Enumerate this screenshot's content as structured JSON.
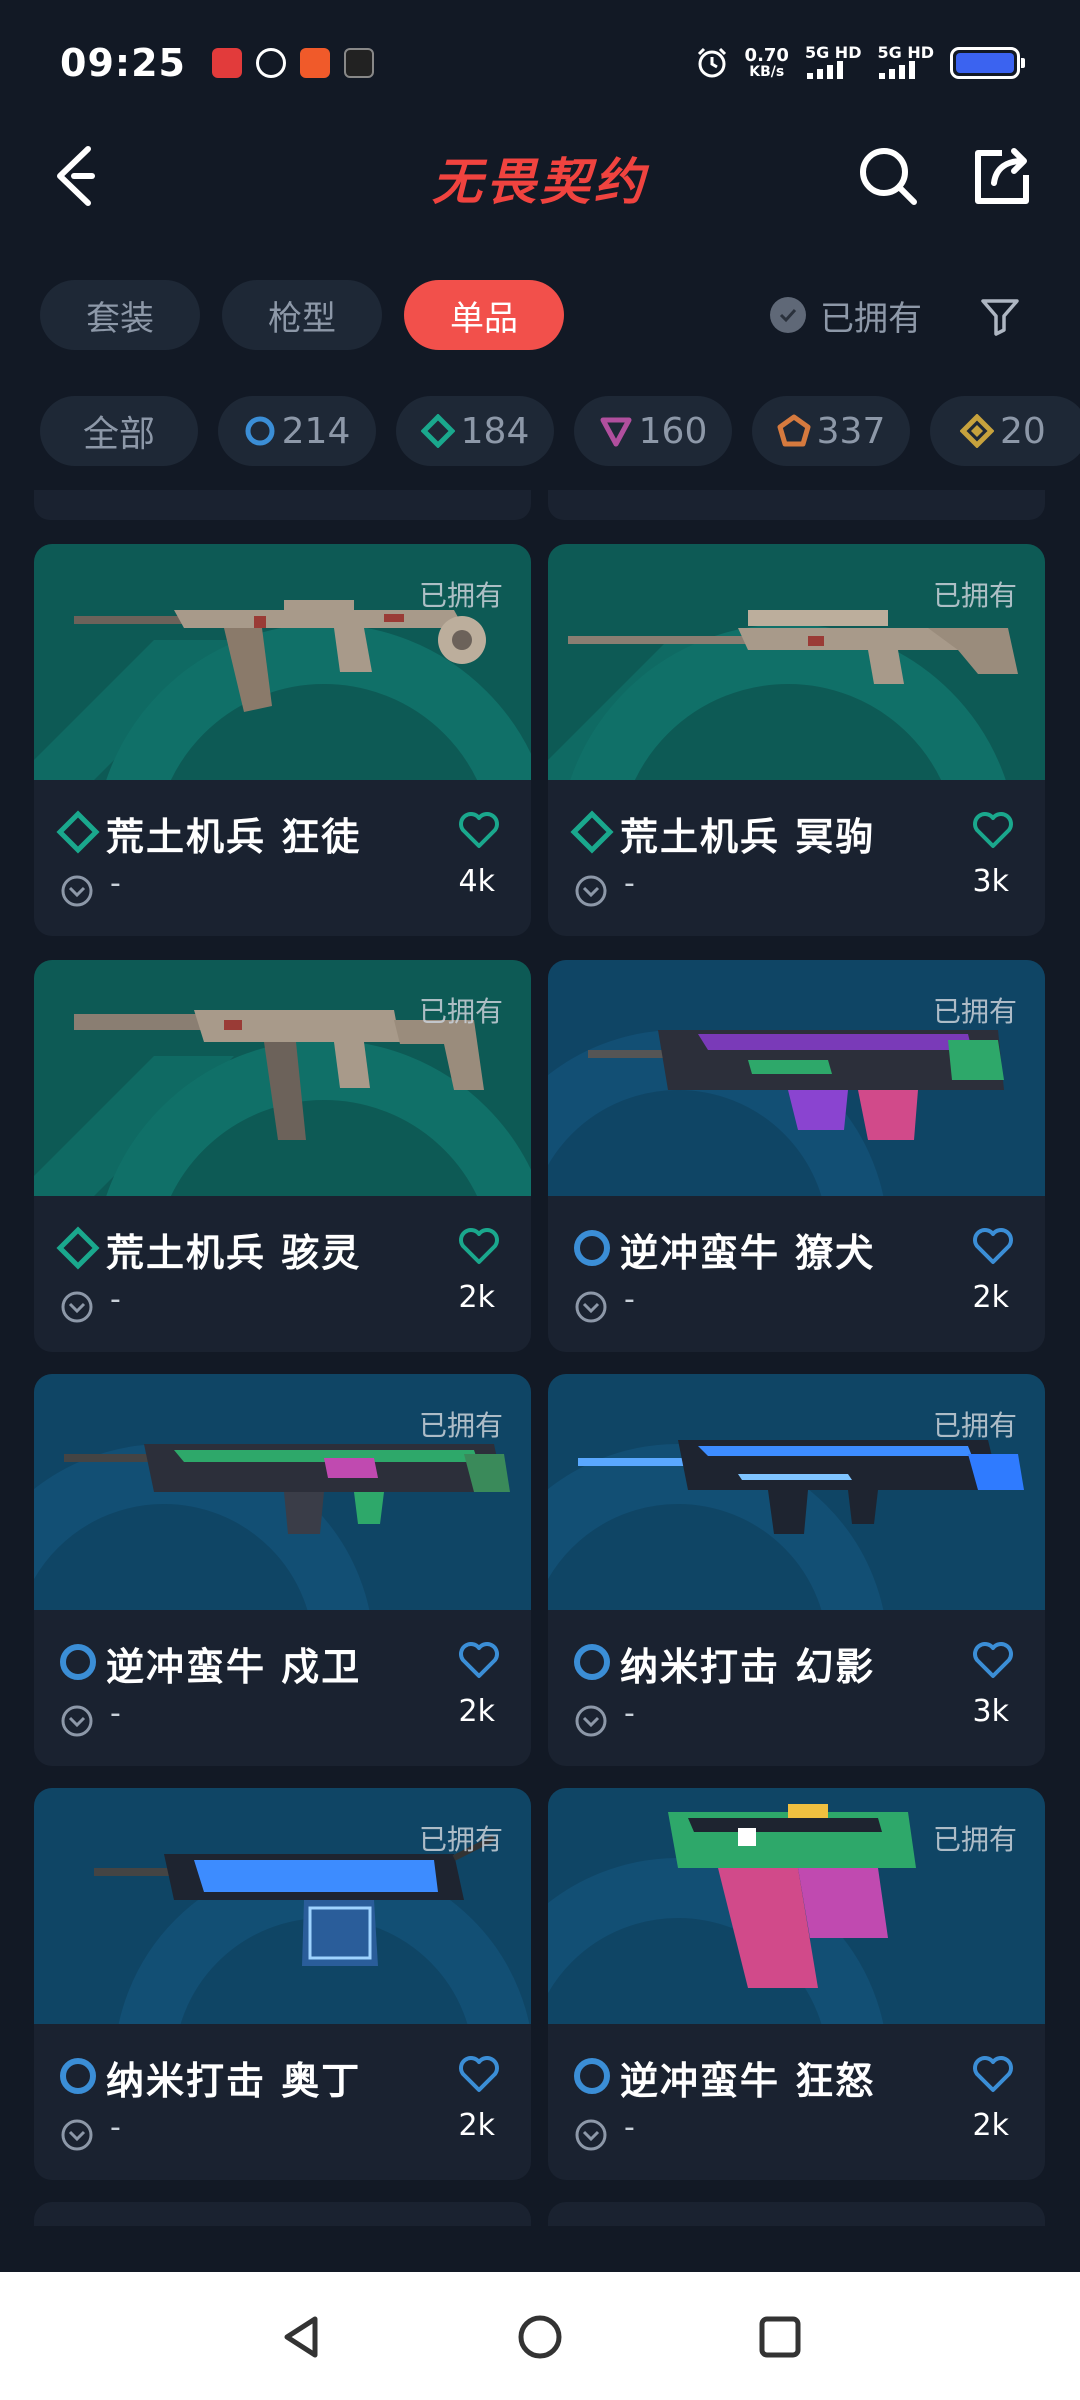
{
  "status_bar": {
    "time": "09:25",
    "net_speed_value": "0.70",
    "net_speed_unit": "KB/s",
    "signal_1": "5G HD",
    "signal_2": "5G HD"
  },
  "header": {
    "title": "无畏契约"
  },
  "category_tabs": [
    {
      "label": "套装"
    },
    {
      "label": "枪型"
    },
    {
      "label": "单品",
      "active": true
    }
  ],
  "owned_filter": {
    "label": "已拥有"
  },
  "tier_chips": [
    {
      "label": "全部"
    },
    {
      "label": "214",
      "tier_color": "#3b8ed6"
    },
    {
      "label": "184",
      "tier_color": "#1aa88d"
    },
    {
      "label": "160",
      "tier_color": "#b14f9e"
    },
    {
      "label": "337",
      "tier_color": "#d67a3e"
    },
    {
      "label": "20",
      "tier_color": "#c7a23d"
    }
  ],
  "items": [
    {
      "name": "荒土机兵 狂徒",
      "owned_label": "已拥有",
      "sub": "-",
      "count": "4k",
      "tier": "green",
      "bg": "teal"
    },
    {
      "name": "荒土机兵 冥驹",
      "owned_label": "已拥有",
      "sub": "-",
      "count": "3k",
      "tier": "green",
      "bg": "teal"
    },
    {
      "name": "荒土机兵 骇灵",
      "owned_label": "已拥有",
      "sub": "-",
      "count": "2k",
      "tier": "green",
      "bg": "teal"
    },
    {
      "name": "逆冲蛮牛 獠犬",
      "owned_label": "已拥有",
      "sub": "-",
      "count": "2k",
      "tier": "blue",
      "bg": "blue"
    },
    {
      "name": "逆冲蛮牛 戍卫",
      "owned_label": "已拥有",
      "sub": "-",
      "count": "2k",
      "tier": "blue",
      "bg": "blue"
    },
    {
      "name": "纳米打击 幻影",
      "owned_label": "已拥有",
      "sub": "-",
      "count": "3k",
      "tier": "blue",
      "bg": "blue"
    },
    {
      "name": "纳米打击 奥丁",
      "owned_label": "已拥有",
      "sub": "-",
      "count": "2k",
      "tier": "blue",
      "bg": "blue"
    },
    {
      "name": "逆冲蛮牛 狂怒",
      "owned_label": "已拥有",
      "sub": "-",
      "count": "2k",
      "tier": "blue",
      "bg": "blue"
    }
  ],
  "colors": {
    "accent": "#f2504b",
    "background": "#121925",
    "card": "#1a2230",
    "tier_green": "#1aa88d",
    "tier_blue": "#3b8ed6"
  }
}
